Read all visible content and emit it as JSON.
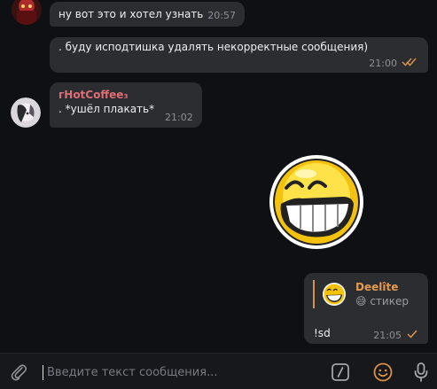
{
  "messages": [
    {
      "text": "ну вот это и хотел узнать",
      "time": "20:57"
    },
    {
      "text": ". буду исподтишка удалять некорректные сообщения)",
      "time": "21:00"
    },
    {
      "sender": "гHotCoffee₃",
      "text": ". *ушёл плакать*",
      "time": "21:02"
    },
    {
      "reply_author": "Deelîte",
      "reply_kind": "😅 стикер",
      "text": "!sd",
      "time": "21:05"
    }
  ],
  "input": {
    "placeholder": "Введите текст сообщения..."
  },
  "colors": {
    "bubble": "#2b2d31",
    "accent": "#d9914a",
    "sender": "#e06c75",
    "background": "#0e1014"
  },
  "icons": [
    "attach-icon",
    "commands-icon",
    "emoji-icon",
    "microphone-icon",
    "sticker-grinning-face",
    "double-check-icon",
    "single-check-icon"
  ]
}
